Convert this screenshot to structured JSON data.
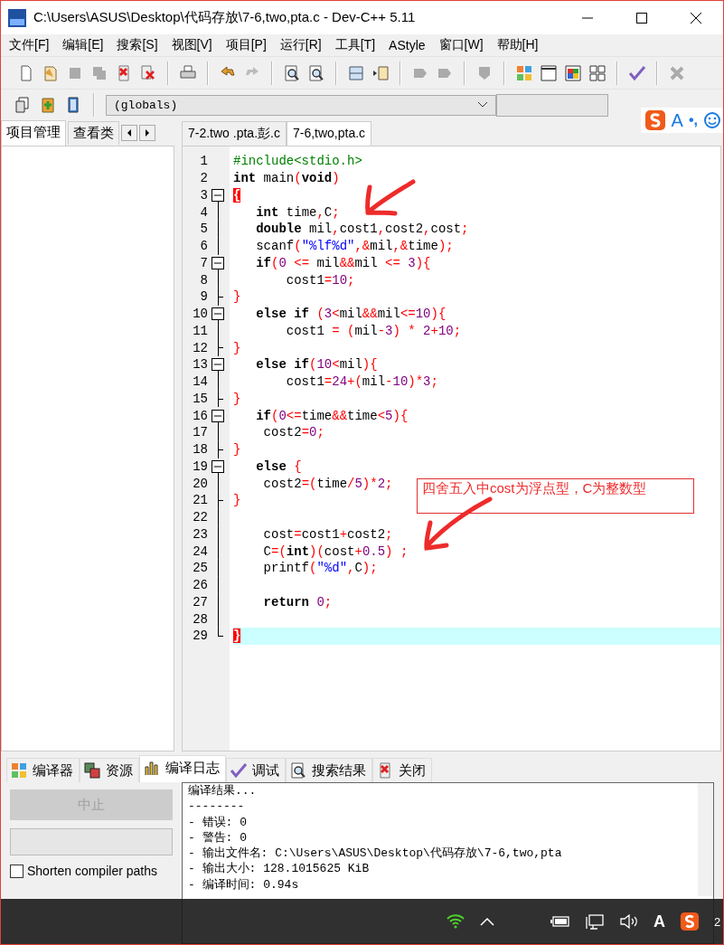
{
  "window": {
    "title": "C:\\Users\\ASUS\\Desktop\\代码存放\\7-6,two,pta.c - Dev-C++ 5.11"
  },
  "menu": [
    "文件[F]",
    "编辑[E]",
    "搜索[S]",
    "视图[V]",
    "项目[P]",
    "运行[R]",
    "工具[T]",
    "AStyle",
    "窗口[W]",
    "帮助[H]"
  ],
  "scope_dropdown": {
    "value": "(globals)"
  },
  "ime_bar": {
    "mode_letter": "A",
    "punctuation": "•,"
  },
  "left_tabs": [
    {
      "label": "项目管理",
      "selected": true
    },
    {
      "label": "查看类",
      "selected": false
    }
  ],
  "editor_tabs": [
    {
      "label": "7-2.two .pta.彭.c",
      "selected": false
    },
    {
      "label": "7-6,two,pta.c",
      "selected": true
    }
  ],
  "code_lines": [
    {
      "number": "1",
      "kind": "plain",
      "current": false,
      "tokens": [
        {
          "kind": "pre",
          "text": "#include<stdio.h>"
        }
      ]
    },
    {
      "number": "2",
      "kind": "plain",
      "current": false,
      "tokens": [
        {
          "kind": "kw",
          "text": "int"
        },
        {
          "kind": "id",
          "text": " main"
        },
        {
          "kind": "sym",
          "text": "("
        },
        {
          "kind": "kw",
          "text": "void"
        },
        {
          "kind": "sym",
          "text": ")"
        }
      ]
    },
    {
      "number": "3",
      "kind": "fold-start",
      "current": false,
      "tokens": [
        {
          "kind": "match",
          "text": "{"
        }
      ]
    },
    {
      "number": "4",
      "kind": "fold-body",
      "current": false,
      "tokens": [
        {
          "kind": "kw",
          "text": "   int"
        },
        {
          "kind": "id",
          "text": " time"
        },
        {
          "kind": "sym",
          "text": ","
        },
        {
          "kind": "id",
          "text": "C"
        },
        {
          "kind": "sym",
          "text": ";"
        }
      ]
    },
    {
      "number": "5",
      "kind": "fold-body",
      "current": false,
      "tokens": [
        {
          "kind": "kw",
          "text": "   double"
        },
        {
          "kind": "id",
          "text": " mil"
        },
        {
          "kind": "sym",
          "text": ","
        },
        {
          "kind": "id",
          "text": "cost1"
        },
        {
          "kind": "sym",
          "text": ","
        },
        {
          "kind": "id",
          "text": "cost2"
        },
        {
          "kind": "sym",
          "text": ","
        },
        {
          "kind": "id",
          "text": "cost"
        },
        {
          "kind": "sym",
          "text": ";"
        }
      ]
    },
    {
      "number": "6",
      "kind": "fold-body",
      "current": false,
      "tokens": [
        {
          "kind": "id",
          "text": "   scanf"
        },
        {
          "kind": "sym",
          "text": "("
        },
        {
          "kind": "str",
          "text": "\"%lf%d\""
        },
        {
          "kind": "sym",
          "text": ",&"
        },
        {
          "kind": "id",
          "text": "mil"
        },
        {
          "kind": "sym",
          "text": ",&"
        },
        {
          "kind": "id",
          "text": "time"
        },
        {
          "kind": "sym",
          "text": ");"
        }
      ]
    },
    {
      "number": "7",
      "kind": "fold-start",
      "current": false,
      "tokens": [
        {
          "kind": "kw",
          "text": "   if"
        },
        {
          "kind": "sym",
          "text": "("
        },
        {
          "kind": "num",
          "text": "0"
        },
        {
          "kind": "sym",
          "text": " <= "
        },
        {
          "kind": "id",
          "text": "mil"
        },
        {
          "kind": "sym",
          "text": "&&"
        },
        {
          "kind": "id",
          "text": "mil"
        },
        {
          "kind": "sym",
          "text": " <= "
        },
        {
          "kind": "num",
          "text": "3"
        },
        {
          "kind": "sym",
          "text": "){"
        }
      ]
    },
    {
      "number": "8",
      "kind": "fold-body",
      "current": false,
      "tokens": [
        {
          "kind": "id",
          "text": "       cost1"
        },
        {
          "kind": "sym",
          "text": "="
        },
        {
          "kind": "num",
          "text": "10"
        },
        {
          "kind": "sym",
          "text": ";"
        }
      ]
    },
    {
      "number": "9",
      "kind": "fold-end",
      "current": false,
      "tokens": [
        {
          "kind": "sym",
          "text": "}"
        }
      ]
    },
    {
      "number": "10",
      "kind": "fold-start",
      "current": false,
      "tokens": [
        {
          "kind": "kw",
          "text": "   else if"
        },
        {
          "kind": "sym",
          "text": " ("
        },
        {
          "kind": "num",
          "text": "3"
        },
        {
          "kind": "sym",
          "text": "<"
        },
        {
          "kind": "id",
          "text": "mil"
        },
        {
          "kind": "sym",
          "text": "&&"
        },
        {
          "kind": "id",
          "text": "mil"
        },
        {
          "kind": "sym",
          "text": "<="
        },
        {
          "kind": "num",
          "text": "10"
        },
        {
          "kind": "sym",
          "text": "){"
        }
      ]
    },
    {
      "number": "11",
      "kind": "fold-body",
      "current": false,
      "tokens": [
        {
          "kind": "id",
          "text": "       cost1 "
        },
        {
          "kind": "sym",
          "text": "= ("
        },
        {
          "kind": "id",
          "text": "mil"
        },
        {
          "kind": "sym",
          "text": "-"
        },
        {
          "kind": "num",
          "text": "3"
        },
        {
          "kind": "sym",
          "text": ") * "
        },
        {
          "kind": "num",
          "text": "2"
        },
        {
          "kind": "sym",
          "text": "+"
        },
        {
          "kind": "num",
          "text": "10"
        },
        {
          "kind": "sym",
          "text": ";"
        }
      ]
    },
    {
      "number": "12",
      "kind": "fold-end",
      "current": false,
      "tokens": [
        {
          "kind": "sym",
          "text": "}"
        }
      ]
    },
    {
      "number": "13",
      "kind": "fold-start",
      "current": false,
      "tokens": [
        {
          "kind": "kw",
          "text": "   else if"
        },
        {
          "kind": "sym",
          "text": "("
        },
        {
          "kind": "num",
          "text": "10"
        },
        {
          "kind": "sym",
          "text": "<"
        },
        {
          "kind": "id",
          "text": "mil"
        },
        {
          "kind": "sym",
          "text": "){"
        }
      ]
    },
    {
      "number": "14",
      "kind": "fold-body",
      "current": false,
      "tokens": [
        {
          "kind": "id",
          "text": "       cost1"
        },
        {
          "kind": "sym",
          "text": "="
        },
        {
          "kind": "num",
          "text": "24"
        },
        {
          "kind": "sym",
          "text": "+("
        },
        {
          "kind": "id",
          "text": "mil"
        },
        {
          "kind": "sym",
          "text": "-"
        },
        {
          "kind": "num",
          "text": "10"
        },
        {
          "kind": "sym",
          "text": ")*"
        },
        {
          "kind": "num",
          "text": "3"
        },
        {
          "kind": "sym",
          "text": ";"
        }
      ]
    },
    {
      "number": "15",
      "kind": "fold-end",
      "current": false,
      "tokens": [
        {
          "kind": "sym",
          "text": "}"
        }
      ]
    },
    {
      "number": "16",
      "kind": "fold-start",
      "current": false,
      "tokens": [
        {
          "kind": "kw",
          "text": "   if"
        },
        {
          "kind": "sym",
          "text": "("
        },
        {
          "kind": "num",
          "text": "0"
        },
        {
          "kind": "sym",
          "text": "<="
        },
        {
          "kind": "id",
          "text": "time"
        },
        {
          "kind": "sym",
          "text": "&&"
        },
        {
          "kind": "id",
          "text": "time"
        },
        {
          "kind": "sym",
          "text": "<"
        },
        {
          "kind": "num",
          "text": "5"
        },
        {
          "kind": "sym",
          "text": "){"
        }
      ]
    },
    {
      "number": "17",
      "kind": "fold-body",
      "current": false,
      "tokens": [
        {
          "kind": "id",
          "text": "    cost2"
        },
        {
          "kind": "sym",
          "text": "="
        },
        {
          "kind": "num",
          "text": "0"
        },
        {
          "kind": "sym",
          "text": ";"
        }
      ]
    },
    {
      "number": "18",
      "kind": "fold-end",
      "current": false,
      "tokens": [
        {
          "kind": "sym",
          "text": "}"
        }
      ]
    },
    {
      "number": "19",
      "kind": "fold-start",
      "current": false,
      "tokens": [
        {
          "kind": "kw",
          "text": "   else"
        },
        {
          "kind": "sym",
          "text": " {"
        }
      ]
    },
    {
      "number": "20",
      "kind": "fold-body",
      "current": false,
      "tokens": [
        {
          "kind": "id",
          "text": "    cost2"
        },
        {
          "kind": "sym",
          "text": "=("
        },
        {
          "kind": "id",
          "text": "time"
        },
        {
          "kind": "sym",
          "text": "/"
        },
        {
          "kind": "num",
          "text": "5"
        },
        {
          "kind": "sym",
          "text": ")*"
        },
        {
          "kind": "num",
          "text": "2"
        },
        {
          "kind": "sym",
          "text": ";"
        }
      ]
    },
    {
      "number": "21",
      "kind": "fold-end",
      "current": false,
      "tokens": [
        {
          "kind": "sym",
          "text": "}"
        }
      ]
    },
    {
      "number": "22",
      "kind": "fold-body",
      "current": false
    },
    {
      "number": "23",
      "kind": "fold-body",
      "current": false,
      "tokens": [
        {
          "kind": "id",
          "text": "    cost"
        },
        {
          "kind": "sym",
          "text": "="
        },
        {
          "kind": "id",
          "text": "cost1"
        },
        {
          "kind": "sym",
          "text": "+"
        },
        {
          "kind": "id",
          "text": "cost2"
        },
        {
          "kind": "sym",
          "text": ";"
        }
      ]
    },
    {
      "number": "24",
      "kind": "fold-body",
      "current": false,
      "tokens": [
        {
          "kind": "id",
          "text": "    C"
        },
        {
          "kind": "sym",
          "text": "=("
        },
        {
          "kind": "kw",
          "text": "int"
        },
        {
          "kind": "sym",
          "text": ")("
        },
        {
          "kind": "id",
          "text": "cost"
        },
        {
          "kind": "sym",
          "text": "+"
        },
        {
          "kind": "num",
          "text": "0.5"
        },
        {
          "kind": "sym",
          "text": ") ;"
        }
      ]
    },
    {
      "number": "25",
      "kind": "fold-body",
      "current": false,
      "tokens": [
        {
          "kind": "id",
          "text": "    printf"
        },
        {
          "kind": "sym",
          "text": "("
        },
        {
          "kind": "str",
          "text": "\"%d\""
        },
        {
          "kind": "sym",
          "text": ","
        },
        {
          "kind": "id",
          "text": "C"
        },
        {
          "kind": "sym",
          "text": ");"
        }
      ]
    },
    {
      "number": "26",
      "kind": "fold-body",
      "current": false
    },
    {
      "number": "27",
      "kind": "fold-body",
      "current": false,
      "tokens": [
        {
          "kind": "kw",
          "text": "    return"
        },
        {
          "kind": "num",
          "text": " 0"
        },
        {
          "kind": "sym",
          "text": ";"
        }
      ]
    },
    {
      "number": "28",
      "kind": "fold-body",
      "current": false
    },
    {
      "number": "29",
      "kind": "fold-last",
      "current": true,
      "tokens": [
        {
          "kind": "match",
          "text": "}"
        }
      ]
    }
  ],
  "annotation": {
    "note": "四舍五入中cost为浮点型，C为整数型"
  },
  "bottom_tabs": [
    {
      "label": "编译器",
      "selected": false
    },
    {
      "label": "资源",
      "selected": false
    },
    {
      "label": "编译日志",
      "selected": true
    },
    {
      "label": "调试",
      "selected": false
    },
    {
      "label": "搜索结果",
      "selected": false
    },
    {
      "label": "关闭",
      "selected": false
    }
  ],
  "compile_panel": {
    "abort_button": {
      "label": "中止",
      "disabled": true
    },
    "progress": {
      "level": 0
    },
    "shorten_paths": {
      "label": "Shorten compiler paths",
      "checked": false
    },
    "log": [
      "编译结果...",
      "--------",
      "- 错误: 0",
      "- 警告: 0",
      "- 输出文件名: C:\\Users\\ASUS\\Desktop\\代码存放\\7-6,two,pta",
      "- 输出大小: 128.1015625 KiB",
      "- 编译时间: 0.94s"
    ]
  },
  "taskbar": {
    "ime_letter": "A",
    "clock": "2"
  }
}
